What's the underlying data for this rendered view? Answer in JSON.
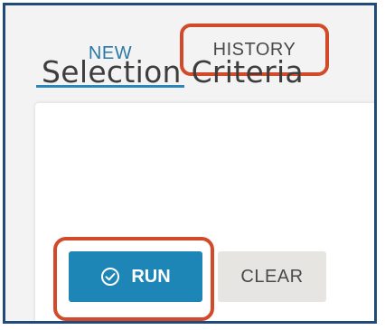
{
  "tabs": [
    {
      "label": "NEW",
      "active": true
    },
    {
      "label": "HISTORY",
      "active": false
    }
  ],
  "panel": {
    "title": "Selection Criteria"
  },
  "buttons": {
    "run_label": "RUN",
    "run_icon": "check-circle-icon",
    "clear_label": "CLEAR"
  },
  "colors": {
    "accent": "#1e86b6",
    "highlight": "#d24a2a",
    "frame": "#1f4a7a"
  }
}
